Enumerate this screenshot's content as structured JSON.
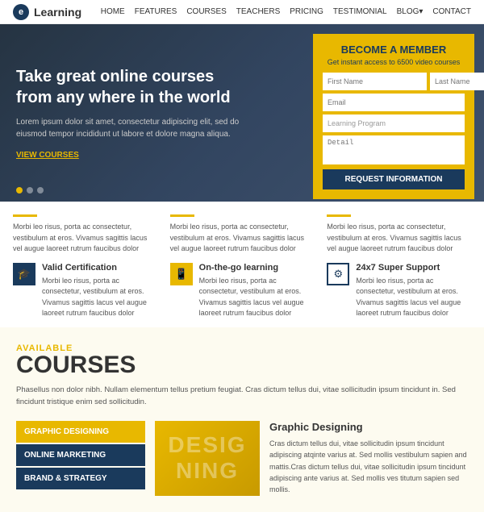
{
  "header": {
    "logo_letter": "e",
    "logo_text": "Learning",
    "nav_items": [
      "HOME",
      "FEATURES",
      "COURSES",
      "TEACHERS",
      "PRICING",
      "TESTIMONIAL",
      "BLOG▾",
      "CONTACT"
    ]
  },
  "hero": {
    "title": "Take great online courses from any where in the world",
    "description": "Lorem ipsum dolor sit amet, consectetur adipiscing elit, sed do eiusmod tempor incididunt ut labore et dolore magna aliqua.",
    "cta_link": "VIEW COURSES",
    "dots": [
      true,
      false,
      false
    ]
  },
  "membership": {
    "title": "BECOME A MEMBER",
    "subtitle": "Get instant access to 6500 video courses",
    "first_name_placeholder": "First Name",
    "last_name_placeholder": "Last Name",
    "email_placeholder": "Email",
    "program_placeholder": "Learning Program",
    "detail_placeholder": "Detail",
    "button_label": "Request Information"
  },
  "features": {
    "col1_text": "Morbi leo risus, porta ac consectetur, vestibulum at eros. Vivamus sagittis lacus vel augue laoreet rutrum faucibus dolor",
    "col2_text": "Morbi leo risus, porta ac consectetur, vestibulum at eros. Vivamus sagittis lacus vel augue laoreet rutrum faucibus dolor",
    "col3_text": "Morbi leo risus, porta ac consectetur, vestibulum at eros. Vivamus sagittis lacus vel augue laoreet rutrum faucibus dolor",
    "items": [
      {
        "icon": "🎓",
        "title": "Valid Certification",
        "text": "Morbi leo risus, porta ac consectetur, vestibulum at eros. Vivamus sagittis lacus vel augue laoreet rutrum faucibus dolor"
      },
      {
        "icon": "📱",
        "title": "On-the-go learning",
        "text": "Morbi leo risus, porta ac consectetur, vestibulum at eros. Vivamus sagittis lacus vel augue laoreet rutrum faucibus dolor"
      },
      {
        "icon": "⚙",
        "title": "24x7 Super Support",
        "text": "Morbi leo risus, porta ac consectetur, vestibulum at eros. Vivamus sagittis lacus vel augue laoreet rutrum faucibus dolor"
      }
    ]
  },
  "courses": {
    "available_label": "AVAILABLE",
    "title": "COURSES",
    "description": "Phasellus non dolor nibh. Nullam elementum tellus pretium feugiat.\nCras dictum tellus dui, vitae sollicitudin ipsum tincidunt in. Sed fincidunt tristique enim sed sollicitudin.",
    "list": [
      {
        "label": "GRAPHIC DESIGNING",
        "active": true
      },
      {
        "label": "ONLINE MARKETING",
        "active": false
      },
      {
        "label": "BRAND & STRATEGY",
        "active": false
      }
    ],
    "thumbnail_text": "DESIG",
    "detail_title": "Graphic Designing",
    "detail_text": "Cras dictum tellus dui, vitae sollicitudin ipsum tincidunt adipiscing atqinte varius at. Sed mollis vestibulum sapien and mattis.Cras dictum tellus dui, vitae sollicitudin ipsum tincidunt adipiscing ante varius at. Sed mollis ves titutum sapien sed mollis."
  }
}
